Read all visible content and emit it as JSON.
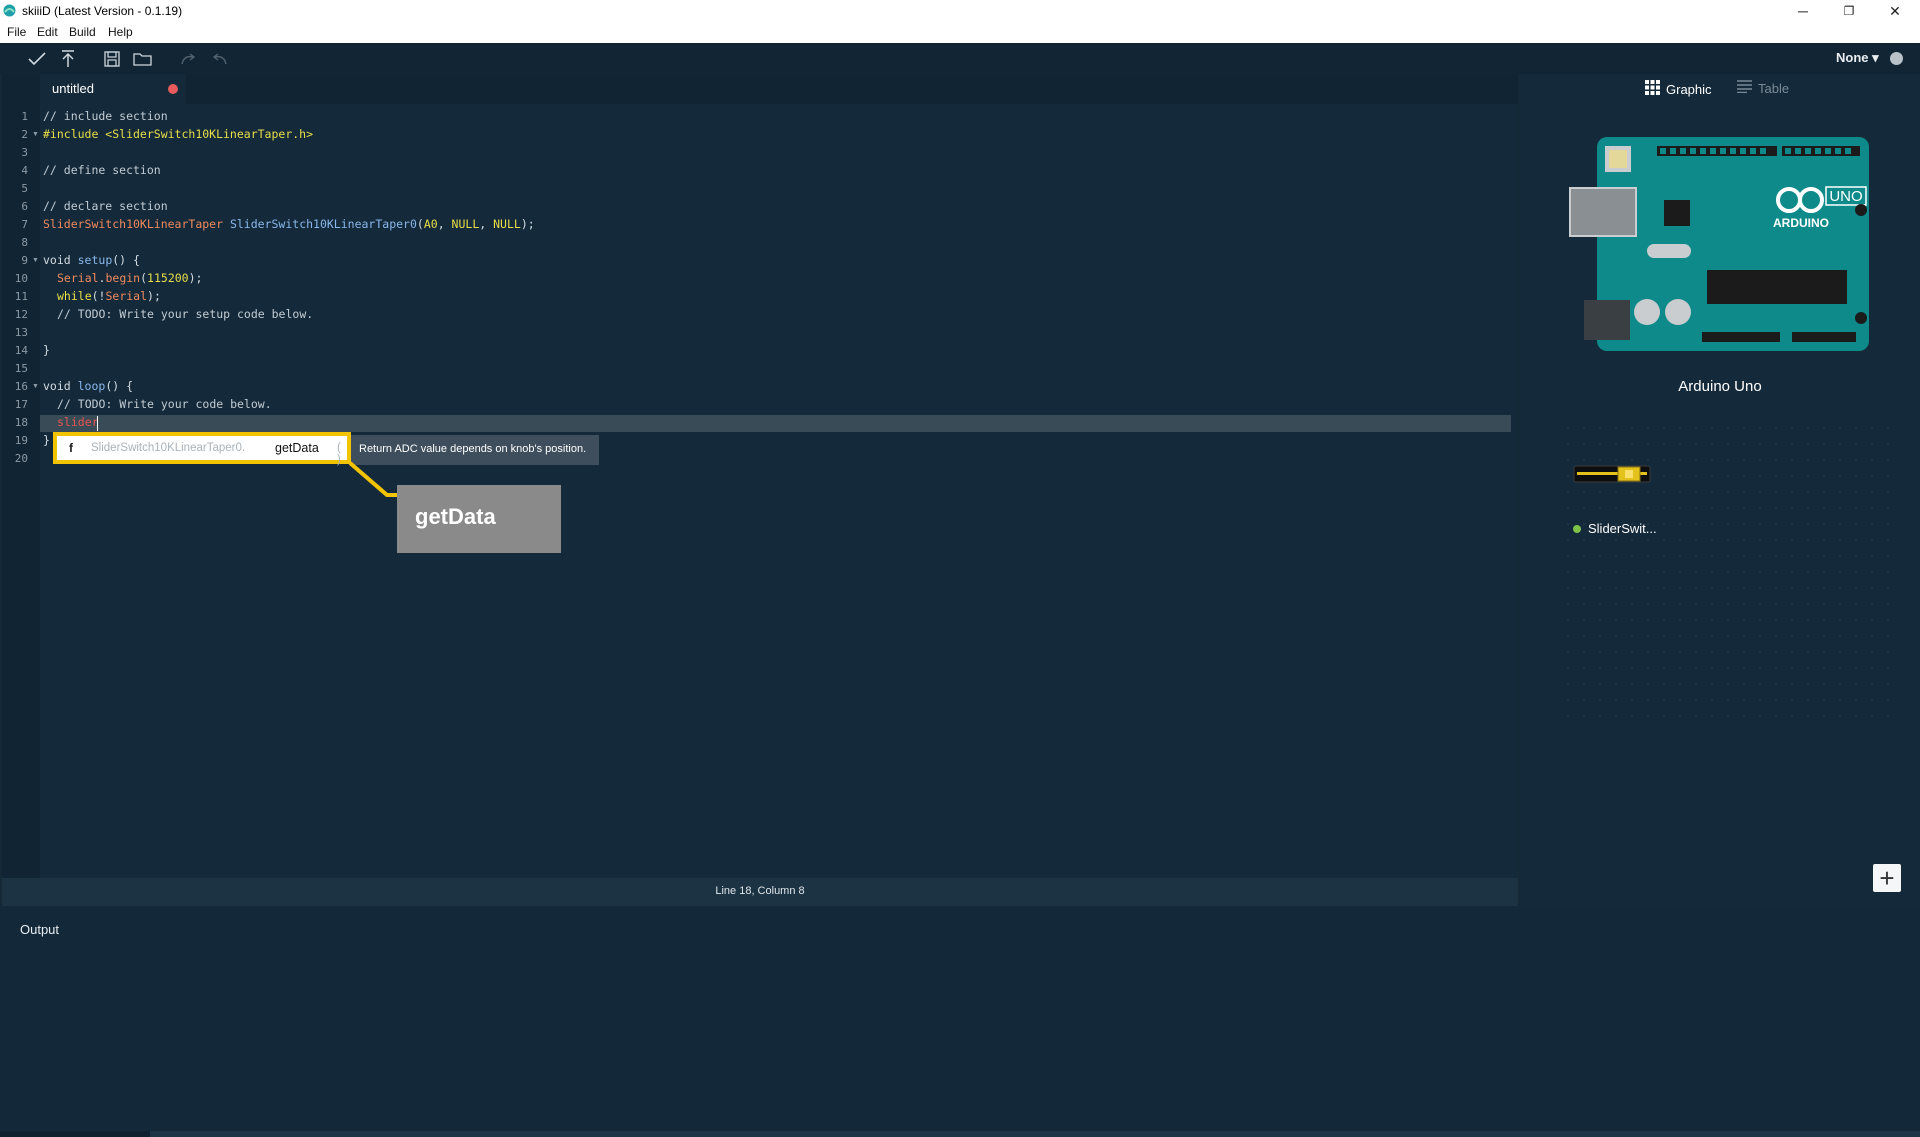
{
  "window": {
    "title": "skiiiD (Latest Version - 0.1.19)",
    "controls": {
      "minimize": "─",
      "restore": "❐",
      "close": "✕"
    }
  },
  "menu": [
    "File",
    "Edit",
    "Build",
    "Help"
  ],
  "toolbar": {
    "icons": [
      "check-icon",
      "upload-icon",
      "save-icon",
      "folder-icon",
      "redo-icon",
      "undo-icon"
    ],
    "board_select": "None ▾"
  },
  "editor": {
    "tab": "untitled",
    "tab_modified_color": "#e85b5b",
    "line_numbers": [
      "1",
      "2",
      "3",
      "4",
      "5",
      "6",
      "7",
      "8",
      "9",
      "10",
      "11",
      "12",
      "13",
      "14",
      "15",
      "16",
      "17",
      "18",
      "19",
      "20"
    ],
    "lines": {
      "l1": "// include section",
      "l2": "#include <SliderSwitch10KLinearTaper.h>",
      "l4": "// define section",
      "l6": "// declare section",
      "l7_type": "SliderSwitch10KLinearTaper",
      "l7_obj": "SliderSwitch10KLinearTaper0",
      "l7_open": "(",
      "l7_a0": "A0",
      "l7_sep1": ", ",
      "l7_null1": "NULL",
      "l7_sep2": ", ",
      "l7_null2": "NULL",
      "l7_close": ");",
      "l9_kw": "void ",
      "l9_fn": "setup",
      "l9_rest": "() {",
      "l10_obj": "Serial",
      "l10_dot": ".",
      "l10_fn": "begin",
      "l10_open": "(",
      "l10_num": "115200",
      "l10_close": ");",
      "l11_kw": "while",
      "l11_open": "(!",
      "l11_obj": "Serial",
      "l11_close": ");",
      "l12": "// TODO: Write your setup code below.",
      "l14": "}",
      "l16_kw": "void ",
      "l16_fn": "loop",
      "l16_rest": "() {",
      "l17": "// TODO: Write your code below.",
      "l18": "slider",
      "l19": "}"
    }
  },
  "autocomplete": {
    "kind": "f",
    "class_prefix": "SliderSwitch10KLinearTaper0.",
    "method": "getData",
    "parens": "( )",
    "tooltip": "Return ADC value depends on knob's position.",
    "callout": "getData",
    "highlight_color": "#f2c400"
  },
  "status": "Line 18, Column 8",
  "right_panel": {
    "view_graphic": "Graphic",
    "view_table": "Table",
    "board_name": "Arduino Uno",
    "board_logo": "ARDUINO",
    "board_model": "UNO",
    "component_label": "SliderSwit...",
    "add_button": "+"
  },
  "output": {
    "label": "Output"
  }
}
